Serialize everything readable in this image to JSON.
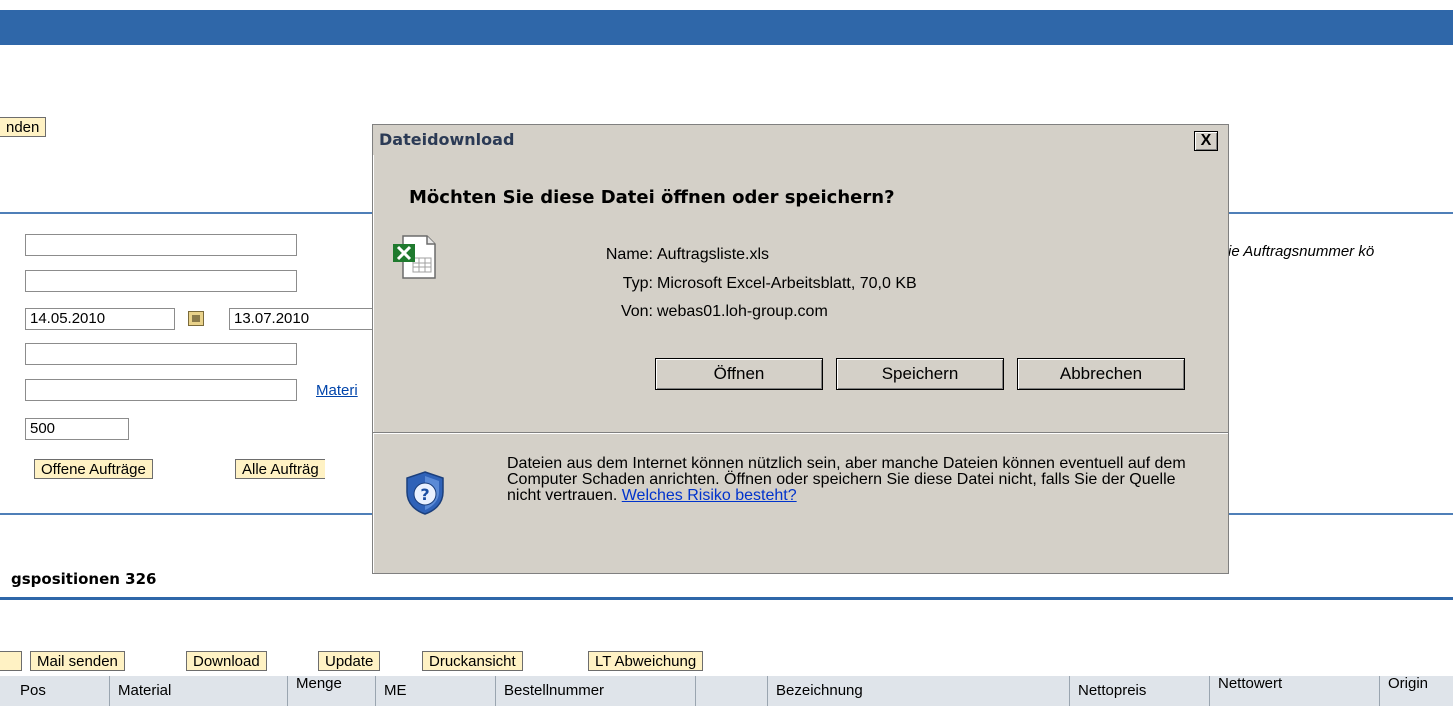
{
  "top": {
    "partial_button": "nden"
  },
  "form": {
    "date_from": "14.05.2010",
    "date_to": "13.07.2010",
    "max_hits": "500",
    "material_link_partial": "Materi",
    "hint_partial": "ie Auftragsnummer kö",
    "btn_open_orders": "Offene Aufträge",
    "btn_all_orders_partial": "Alle Aufträg"
  },
  "section": {
    "title": "gspositionen 326"
  },
  "toolbar": {
    "mail": "Mail senden",
    "download": "Download",
    "update": "Update",
    "print": "Druckansicht",
    "lt": "LT Abweichung"
  },
  "table": {
    "headers": [
      "Pos",
      "Material",
      "Menge",
      "ME",
      "Bestellnummer",
      "",
      "Bezeichnung",
      "Nettopreis",
      "Nettowert",
      "Origin"
    ]
  },
  "dialog": {
    "title": "Dateidownload",
    "close": "X",
    "question": "Möchten Sie diese Datei öffnen oder speichern?",
    "name_label": "Name:",
    "name_value": "Auftragsliste.xls",
    "type_label": "Typ:",
    "type_value": "Microsoft Excel-Arbeitsblatt, 70,0 KB",
    "from_label": "Von:",
    "from_value": "webas01.loh-group.com",
    "btn_open": "Öffnen",
    "btn_save": "Speichern",
    "btn_cancel": "Abbrechen",
    "warning": "Dateien aus dem Internet können nützlich sein, aber manche Dateien können eventuell auf dem Computer Schaden anrichten. Öffnen oder speichern Sie diese Datei nicht, falls Sie der Quelle nicht vertrauen.",
    "risk_link": "Welches Risiko besteht?"
  },
  "colors": {
    "sap_blue": "#2f67a9",
    "button_bg": "#fff2c4",
    "dialog_bg": "#d4d0c8"
  },
  "icons": {
    "file": "excel-file-icon",
    "shield": "security-shield-icon",
    "calendar": "calendar-icon"
  }
}
